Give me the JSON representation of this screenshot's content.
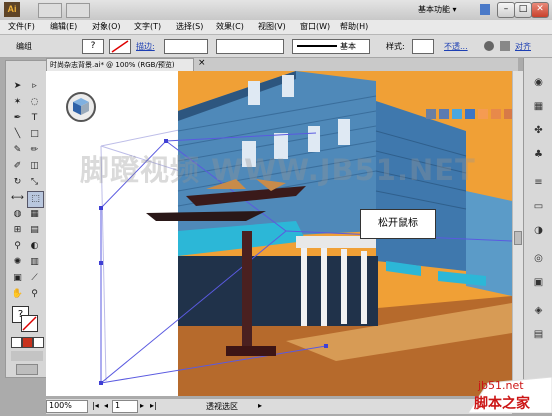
{
  "titlebar": {
    "logo": "Ai",
    "workspace": "基本功能 ▾",
    "btn_min": "–",
    "btn_max": "□",
    "btn_close": "✕"
  },
  "menubar": {
    "items": [
      "文件(F)",
      "编辑(E)",
      "对象(O)",
      "文字(T)",
      "选择(S)",
      "效果(C)",
      "视图(V)",
      "窗口(W)",
      "帮助(H)"
    ]
  },
  "controlbar": {
    "group_label": "编组",
    "stroke_label": "描边:",
    "stroke_style": "基本",
    "style_label": "样式:",
    "opacity_label": "不透...",
    "extra_label": "对齐"
  },
  "document": {
    "tab_title": "时尚杂志背景.ai* @ 100% (RGB/预览)",
    "tab_close": "×"
  },
  "canvas": {
    "tooltip": "松开鼠标",
    "watermark": "脚蹬视频 WWW.JB51.NET",
    "palette_colors": [
      "#6a7fa3",
      "#5b7bb1",
      "#4aa7de",
      "#3d76c4",
      "#f59b52",
      "#e8894a",
      "#d77a47"
    ]
  },
  "status": {
    "zoom": "100%",
    "page": "1",
    "mode": "透视选区"
  },
  "footer": {
    "site": "jb51.net",
    "brand": "脚本之家"
  }
}
